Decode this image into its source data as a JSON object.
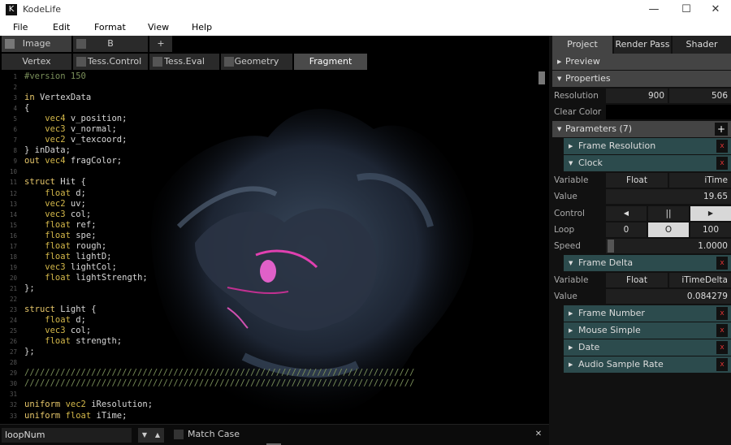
{
  "window": {
    "title": "KodeLife",
    "app_icon": "K",
    "min": "—",
    "max": "☐",
    "close": "✕"
  },
  "menu": [
    "File",
    "Edit",
    "Format",
    "View",
    "Help"
  ],
  "editor_tabs": [
    {
      "label": "Image",
      "checked": true
    },
    {
      "label": "B",
      "checked": false
    }
  ],
  "add_tab": "+",
  "stage_tabs": [
    {
      "label": "Vertex",
      "checkbox": false
    },
    {
      "label": "Tess.Control",
      "checkbox": true
    },
    {
      "label": "Tess.Eval",
      "checkbox": true
    },
    {
      "label": "Geometry",
      "checkbox": true
    },
    {
      "label": "Fragment",
      "checkbox": false,
      "active": true
    }
  ],
  "code_lines": [
    [
      [
        "cm",
        "#version 150"
      ]
    ],
    [],
    [
      [
        "kw",
        "in"
      ],
      [
        "pl",
        " VertexData"
      ]
    ],
    [
      [
        "pl",
        "{"
      ]
    ],
    [
      [
        "ty",
        "    vec4"
      ],
      [
        "pl",
        " v_position;"
      ]
    ],
    [
      [
        "ty",
        "    vec3"
      ],
      [
        "pl",
        " v_normal;"
      ]
    ],
    [
      [
        "ty",
        "    vec2"
      ],
      [
        "pl",
        " v_texcoord;"
      ]
    ],
    [
      [
        "pl",
        "} inData;"
      ]
    ],
    [
      [
        "kw",
        "out"
      ],
      [
        "ty",
        " vec4"
      ],
      [
        "pl",
        " fragColor;"
      ]
    ],
    [],
    [
      [
        "kw",
        "struct"
      ],
      [
        "pl",
        " Hit {"
      ]
    ],
    [
      [
        "ty",
        "    float"
      ],
      [
        "pl",
        " d;"
      ]
    ],
    [
      [
        "ty",
        "    vec2"
      ],
      [
        "pl",
        " uv;"
      ]
    ],
    [
      [
        "ty",
        "    vec3"
      ],
      [
        "pl",
        " col;"
      ]
    ],
    [
      [
        "ty",
        "    float"
      ],
      [
        "pl",
        " ref;"
      ]
    ],
    [
      [
        "ty",
        "    float"
      ],
      [
        "pl",
        " spe;"
      ]
    ],
    [
      [
        "ty",
        "    float"
      ],
      [
        "pl",
        " rough;"
      ]
    ],
    [
      [
        "ty",
        "    float"
      ],
      [
        "pl",
        " lightD;"
      ]
    ],
    [
      [
        "ty",
        "    vec3"
      ],
      [
        "pl",
        " lightCol;"
      ]
    ],
    [
      [
        "ty",
        "    float"
      ],
      [
        "pl",
        " lightStrength;"
      ]
    ],
    [
      [
        "pl",
        "};"
      ]
    ],
    [],
    [
      [
        "kw",
        "struct"
      ],
      [
        "pl",
        " Light {"
      ]
    ],
    [
      [
        "ty",
        "    float"
      ],
      [
        "pl",
        " d;"
      ]
    ],
    [
      [
        "ty",
        "    vec3"
      ],
      [
        "pl",
        " col;"
      ]
    ],
    [
      [
        "ty",
        "    float"
      ],
      [
        "pl",
        " strength;"
      ]
    ],
    [
      [
        "pl",
        "};"
      ]
    ],
    [],
    [
      [
        "cm",
        "////////////////////////////////////////////////////////////////////////////"
      ]
    ],
    [
      [
        "cm",
        "////////////////////////////////////////////////////////////////////////////"
      ]
    ],
    [],
    [
      [
        "kw",
        "uniform"
      ],
      [
        "ty",
        " vec2"
      ],
      [
        "pl",
        " iResolution;"
      ]
    ],
    [
      [
        "kw",
        "uniform"
      ],
      [
        "ty",
        " float"
      ],
      [
        "pl",
        " iTime;"
      ]
    ]
  ],
  "find": {
    "value": "loopNum",
    "down": "▼",
    "up": "▲",
    "match_case": "Match Case",
    "close": "✕"
  },
  "panel": {
    "tabs": [
      "Project",
      "Render Pass",
      "Shader Stage"
    ],
    "preview": "Preview",
    "properties": "Properties",
    "resolution_label": "Resolution",
    "res_w": "900",
    "res_h": "506",
    "clear_color_label": "Clear Color",
    "parameters": "Parameters (7)",
    "param_add": "+",
    "frame_resolution": "Frame Resolution",
    "clock": "Clock",
    "variable_label": "Variable",
    "clock_type": "Float",
    "clock_var": "iTime",
    "value_label": "Value",
    "clock_value": "19.65",
    "control_label": "Control",
    "rewind": "◀",
    "pause": "||",
    "play": "▶",
    "loop_label": "Loop",
    "loop_min": "0",
    "loop_mid": "O",
    "loop_max": "100",
    "speed_label": "Speed",
    "speed_value": "1.0000",
    "frame_delta": "Frame Delta",
    "fd_type": "Float",
    "fd_var": "iTimeDelta",
    "fd_value": "0.084279",
    "frame_number": "Frame Number",
    "mouse_simple": "Mouse Simple",
    "date": "Date",
    "audio_sample_rate": "Audio Sample Rate",
    "remove": "x",
    "arrow_right": "▶",
    "arrow_down": "▼"
  }
}
